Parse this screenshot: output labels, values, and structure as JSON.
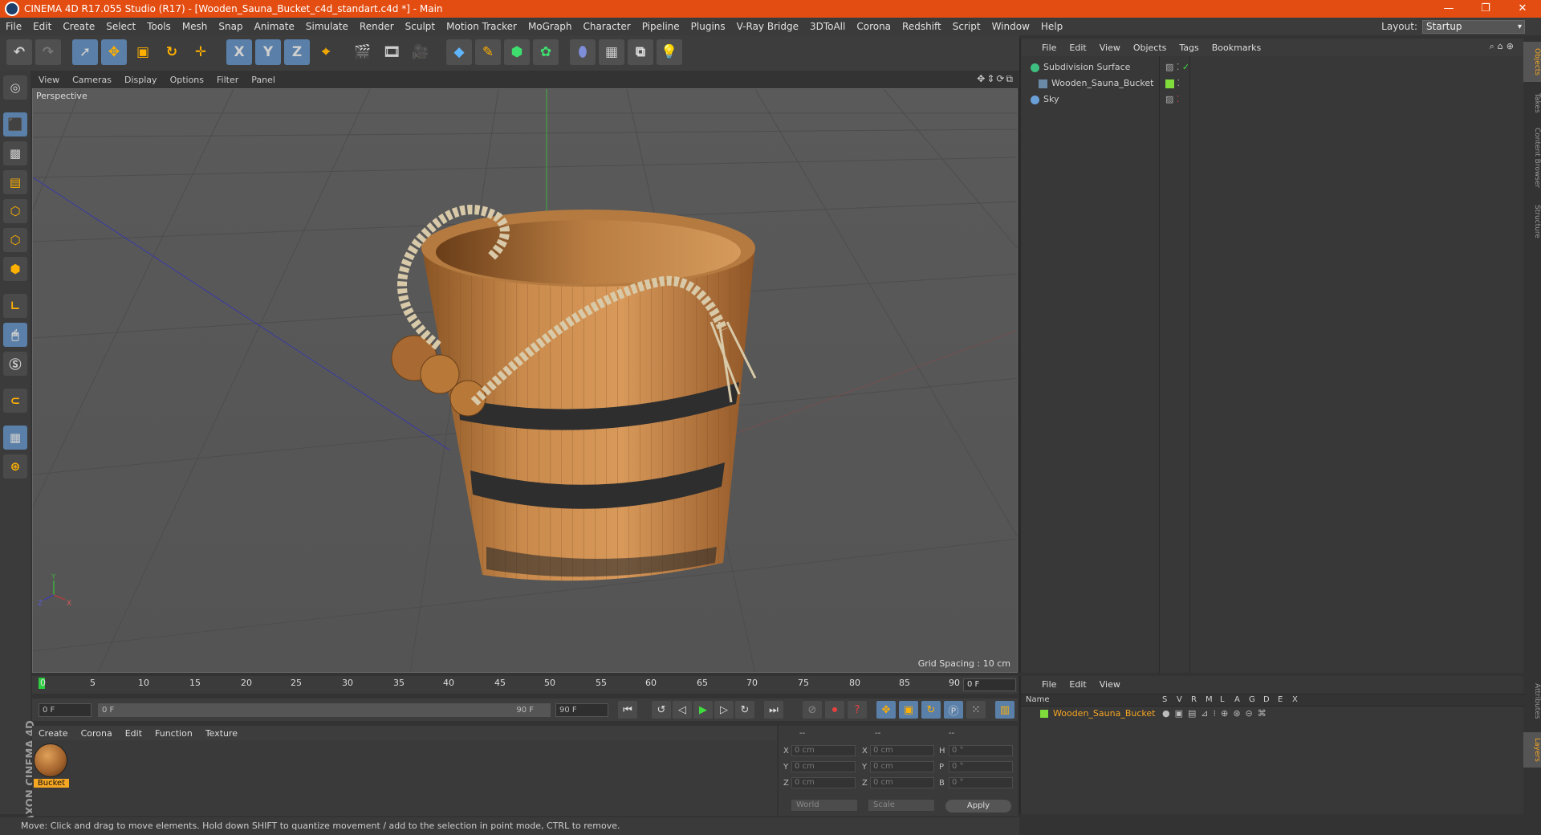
{
  "window": {
    "title": "CINEMA 4D R17.055 Studio (R17) - [Wooden_Sauna_Bucket_c4d_standart.c4d *] - Main",
    "controls": [
      "—",
      "❐",
      "✕"
    ]
  },
  "menubar": {
    "items": [
      "File",
      "Edit",
      "Create",
      "Select",
      "Tools",
      "Mesh",
      "Snap",
      "Animate",
      "Simulate",
      "Render",
      "Sculpt",
      "Motion Tracker",
      "MoGraph",
      "Character",
      "Pipeline",
      "Plugins",
      "V-Ray Bridge",
      "3DToAll",
      "Corona",
      "Redshift",
      "Script",
      "Window",
      "Help"
    ],
    "layout_label": "Layout:",
    "layout_value": "Startup"
  },
  "toolbar": {
    "axis_x": "X",
    "axis_y": "Y",
    "axis_z": "Z"
  },
  "viewport": {
    "menu": [
      "View",
      "Cameras",
      "Display",
      "Options",
      "Filter",
      "Panel"
    ],
    "label": "Perspective",
    "grid_spacing": "Grid Spacing : 10 cm",
    "axis_labels": {
      "y": "Y",
      "z": "Z",
      "x": "X"
    }
  },
  "timeline": {
    "ticks": [
      "0",
      "5",
      "10",
      "15",
      "20",
      "25",
      "30",
      "35",
      "40",
      "45",
      "50",
      "55",
      "60",
      "65",
      "70",
      "75",
      "80",
      "85",
      "90"
    ],
    "current_frame": "0 F"
  },
  "playback": {
    "start_field": "0 F",
    "range_start": "0 F",
    "range_end": "90 F",
    "end_field": "90 F"
  },
  "material_manager": {
    "menu": [
      "Create",
      "Corona",
      "Edit",
      "Function",
      "Texture"
    ],
    "materials": [
      {
        "name": "Bucket"
      }
    ]
  },
  "coordinates": {
    "header": [
      "--",
      "--",
      "--"
    ],
    "rows": [
      {
        "a": "X",
        "av": "0 cm",
        "b": "X",
        "bv": "0 cm",
        "c": "H",
        "cv": "0 °"
      },
      {
        "a": "Y",
        "av": "0 cm",
        "b": "Y",
        "bv": "0 cm",
        "c": "P",
        "cv": "0 °"
      },
      {
        "a": "Z",
        "av": "0 cm",
        "b": "Z",
        "bv": "0 cm",
        "c": "B",
        "cv": "0 °"
      }
    ],
    "mode": "World",
    "transform": "Scale",
    "apply": "Apply"
  },
  "status": {
    "text": "Move: Click and drag to move elements. Hold down SHIFT to quantize movement / add to the selection in point mode, CTRL to remove."
  },
  "object_manager": {
    "menu": [
      "File",
      "Edit",
      "View",
      "Objects",
      "Tags",
      "Bookmarks"
    ],
    "objects": [
      {
        "name": "Subdivision Surface",
        "color": "#3fbf7f"
      },
      {
        "name": "Wooden_Sauna_Bucket",
        "color": "#5fcf5f"
      },
      {
        "name": "Sky",
        "color": "#6aa0d8"
      }
    ]
  },
  "right_tabs": [
    "Objects",
    "Takes",
    "Content Browser",
    "Structure",
    "Attributes",
    "Layers"
  ],
  "layer_manager": {
    "menu": [
      "File",
      "Edit",
      "View"
    ],
    "columns": [
      "Name",
      "S",
      "V",
      "R",
      "M",
      "L",
      "A",
      "G",
      "D",
      "E",
      "X"
    ],
    "layers": [
      {
        "name": "Wooden_Sauna_Bucket",
        "color": "#7fdc3a"
      }
    ]
  },
  "branding": {
    "maxon": "MAXON",
    "product": "CINEMA 4D"
  },
  "colors": {
    "title_bar": "#e44d11",
    "accent_blue": "#5a7fa8",
    "material_tag": "#f5a623"
  }
}
